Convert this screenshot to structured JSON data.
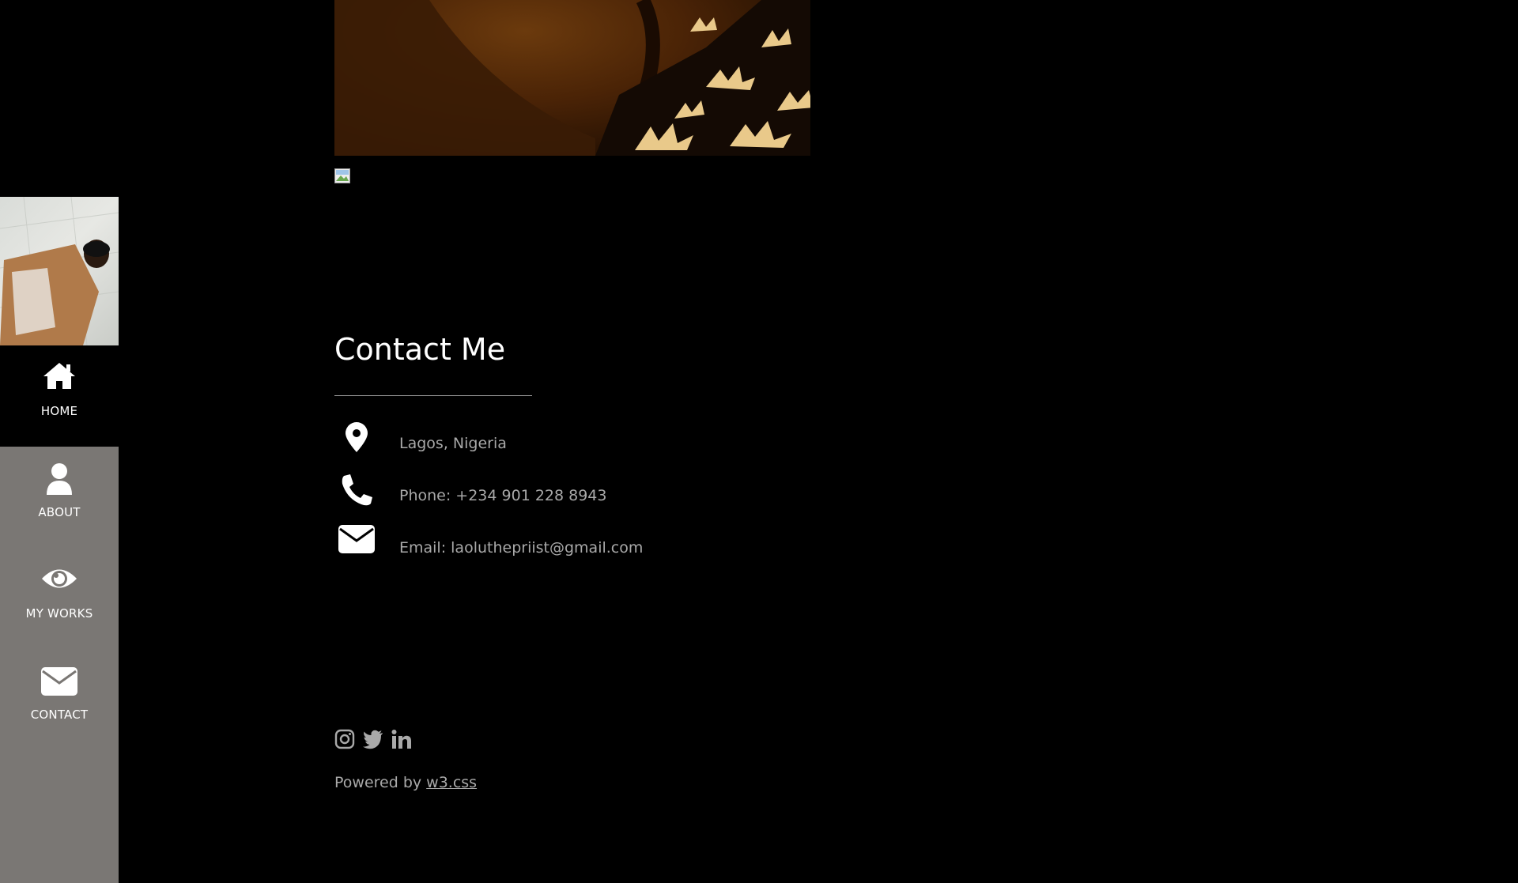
{
  "sidebar": {
    "items": [
      {
        "label": "HOME",
        "icon": "home-icon"
      },
      {
        "label": "ABOUT",
        "icon": "user-icon"
      },
      {
        "label": "MY WORKS",
        "icon": "eye-icon"
      },
      {
        "label": "CONTACT",
        "icon": "envelope-icon"
      }
    ]
  },
  "contact": {
    "title": "Contact Me",
    "location": "Lagos, Nigeria",
    "phone": "Phone: +234 901 228 8943",
    "email": "Email: laoluthepriist@gmail.com"
  },
  "socials": [
    "instagram-icon",
    "twitter-icon",
    "linkedin-icon"
  ],
  "footer": {
    "powered_prefix": "Powered by ",
    "powered_link": "w3.css"
  },
  "colors": {
    "background": "#000000",
    "sidebar": "#7a7774",
    "muted_text": "#a9a9a9"
  }
}
